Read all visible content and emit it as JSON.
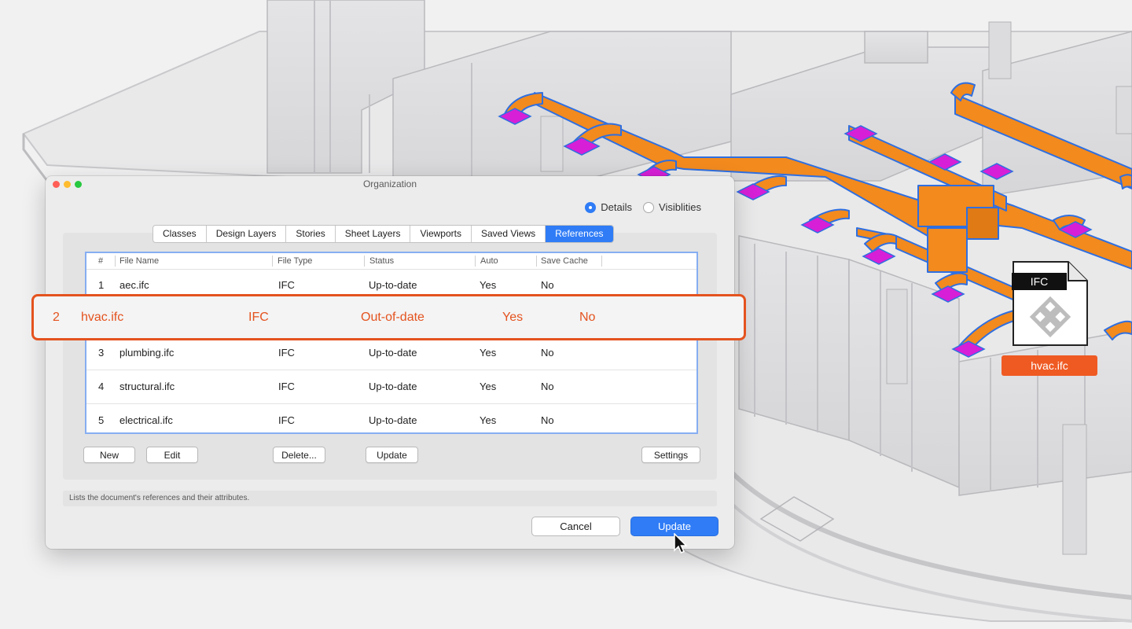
{
  "window": {
    "title": "Organization",
    "view_options": [
      {
        "label": "Details",
        "selected": true
      },
      {
        "label": "Visiblities",
        "selected": false
      }
    ],
    "tabs": [
      {
        "label": "Classes",
        "active": false
      },
      {
        "label": "Design Layers",
        "active": false
      },
      {
        "label": "Stories",
        "active": false
      },
      {
        "label": "Sheet Layers",
        "active": false
      },
      {
        "label": "Viewports",
        "active": false
      },
      {
        "label": "Saved Views",
        "active": false
      },
      {
        "label": "References",
        "active": true
      }
    ],
    "table": {
      "columns": [
        "#",
        "File Name",
        "File Type",
        "Status",
        "Auto",
        "Save Cache"
      ],
      "rows": [
        {
          "num": "1",
          "name": "aec.ifc",
          "type": "IFC",
          "status": "Up-to-date",
          "auto": "Yes",
          "cache": "No"
        },
        {
          "num": "2",
          "name": "hvac.ifc",
          "type": "IFC",
          "status": "Out-of-date",
          "auto": "Yes",
          "cache": "No"
        },
        {
          "num": "3",
          "name": "plumbing.ifc",
          "type": "IFC",
          "status": "Up-to-date",
          "auto": "Yes",
          "cache": "No"
        },
        {
          "num": "4",
          "name": "structural.ifc",
          "type": "IFC",
          "status": "Up-to-date",
          "auto": "Yes",
          "cache": "No"
        },
        {
          "num": "5",
          "name": "electrical.ifc",
          "type": "IFC",
          "status": "Up-to-date",
          "auto": "Yes",
          "cache": "No"
        }
      ]
    },
    "buttons": {
      "new": "New",
      "edit": "Edit",
      "delete": "Delete...",
      "update": "Update",
      "settings": "Settings"
    },
    "hint": "Lists the document's references and their attributes.",
    "footer": {
      "cancel": "Cancel",
      "update": "Update"
    }
  },
  "file_badge": {
    "type": "IFC",
    "filename": "hvac.ifc"
  },
  "colors": {
    "accent_blue": "#2f7cf6",
    "highlight_orange": "#e4531f",
    "duct_orange": "#f28a1e",
    "duct_outline": "#2f6fe0",
    "diffuser_magenta": "#d61fd6"
  },
  "icons": {
    "file": "ifc-file-icon",
    "cursor": "pointer-cursor-icon"
  }
}
